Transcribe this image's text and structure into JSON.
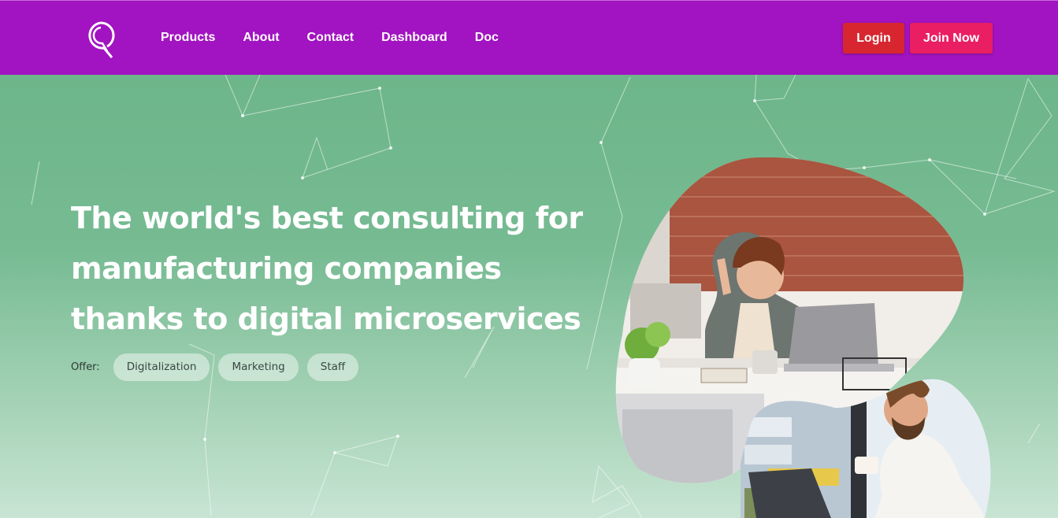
{
  "nav": {
    "logo_icon": "q-logo-icon",
    "links": [
      "Products",
      "About",
      "Contact",
      "Dashboard",
      "Doc"
    ],
    "login_label": "Login",
    "join_label": "Join Now"
  },
  "hero": {
    "headline_lines": [
      "The world's best consulting for",
      "manufacturing companies",
      "thanks to digital microservices"
    ],
    "offer_label": "Offer:",
    "offer_tags": [
      "Digitalization",
      "Marketing",
      "Staff"
    ],
    "image_top": "woman-waving-at-laptop-photo",
    "image_bottom": "man-smiling-at-laptop-photo"
  },
  "colors": {
    "navbar": "#a213c1",
    "login": "#d7262f",
    "join": "#e91e63",
    "hero_top": "#6db58a",
    "hero_bottom": "#c8e5d3"
  }
}
